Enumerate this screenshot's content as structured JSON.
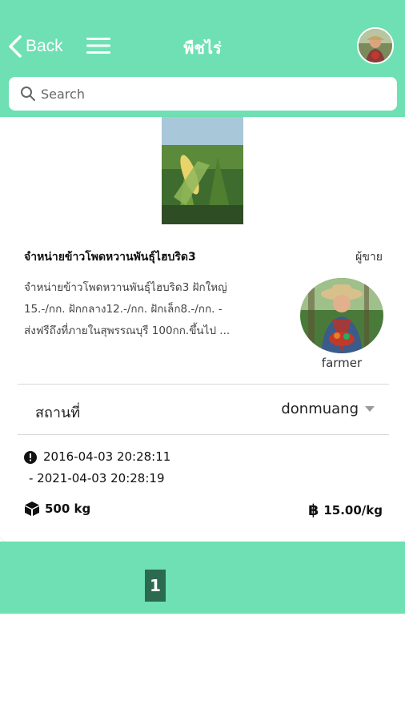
{
  "header": {
    "back_label": "Back",
    "title": "พืชไร่",
    "bg_color": "#6ee0b3"
  },
  "search": {
    "placeholder": "Search",
    "value": ""
  },
  "product": {
    "title": "จำหน่ายข้าวโพดหวานพันธุ์ไฮบริด3",
    "seller_label": "ผู้ขาย",
    "description_lines": [
      "จำหน่ายข้าวโพดหวานพันธุ์ไฮบริด3 ฝักใหญ่",
      "15.-/กก. ฝักกลาง12.-/กก. ฝักเล็ก8.-/กก. -",
      "ส่งฟรีถึงที่ภายในสุพรรณบุรี 100กก.ขึ้นไป ..."
    ],
    "seller_name": "farmer",
    "location_label": "สถานที่",
    "location_value": "donmuang",
    "date_start": "2016-04-03 20:28:11",
    "date_end": "- 2021-04-03 20:28:19",
    "quantity": "500  kg",
    "price": "15.00/kg",
    "price_currency_symbol": "฿"
  },
  "pagination": {
    "current_page": "1",
    "active_color": "#2c6a4f"
  },
  "icons": [
    "chevron-left-icon",
    "menu-icon",
    "search-icon",
    "clock-icon",
    "box-icon",
    "baht-icon",
    "caret-down-icon"
  ]
}
